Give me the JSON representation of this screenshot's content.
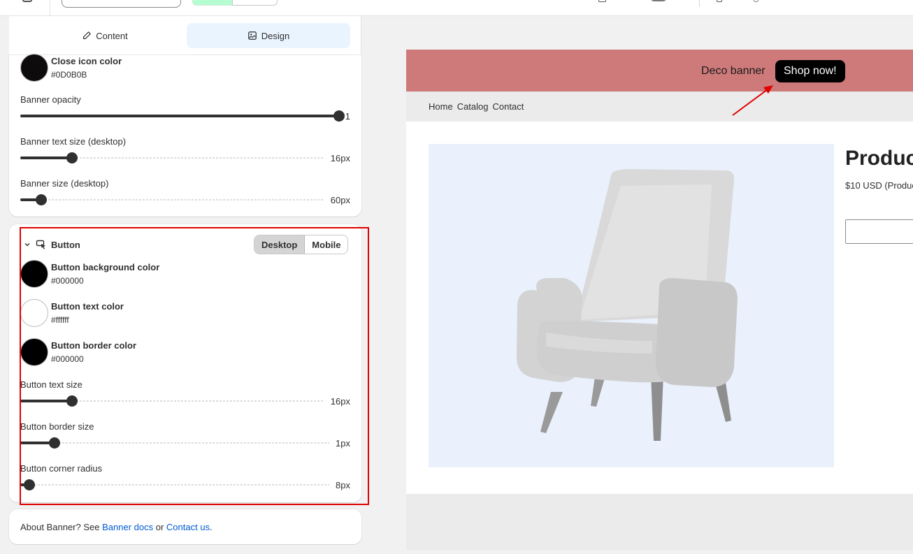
{
  "tabs": {
    "content": "Content",
    "design": "Design"
  },
  "banner_section": {
    "close_icon": {
      "title": "Close icon color",
      "hex": "#0D0B0B",
      "color": "#0d0b0b"
    },
    "sliders": [
      {
        "label": "Banner opacity",
        "value": "1",
        "fraction": 1.0
      },
      {
        "label": "Banner text size (desktop)",
        "value": "16px",
        "fraction": 0.17
      },
      {
        "label": "Banner size (desktop)",
        "value": "60px",
        "fraction": 0.07
      }
    ]
  },
  "button_section": {
    "title": "Button",
    "seg": {
      "desktop": "Desktop",
      "mobile": "Mobile"
    },
    "colors": [
      {
        "title": "Button background color",
        "hex": "#000000",
        "color": "#000000"
      },
      {
        "title": "Button text color",
        "hex": "#ffffff",
        "color": "#ffffff"
      },
      {
        "title": "Button border color",
        "hex": "#000000",
        "color": "#000000"
      }
    ],
    "sliders": [
      {
        "label": "Button text size",
        "value": "16px",
        "fraction": 0.17
      },
      {
        "label": "Button border size",
        "value": "1px",
        "fraction": 0.11
      },
      {
        "label": "Button corner radius",
        "value": "8px",
        "fraction": 0.03
      }
    ]
  },
  "footer": {
    "prefix": "About Banner? See",
    "docs": "Banner docs",
    "or": "or",
    "contact": "Contact us",
    "period": "."
  },
  "preview": {
    "banner_text": "Deco banner",
    "button_label": "Shop now!",
    "banner_color": "#ce7a7a",
    "nav": [
      "Home",
      "Catalog",
      "Contact"
    ],
    "product_title": "Produc",
    "product_price": "$10 USD (Produc"
  },
  "accent": {
    "highlight": "#e00000",
    "link": "#005bd3"
  }
}
